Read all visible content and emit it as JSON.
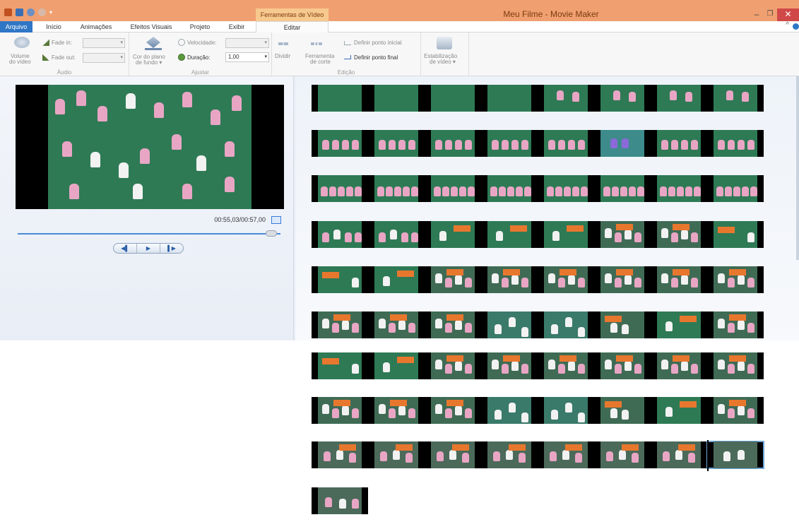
{
  "colors": {
    "titlebar": "#f0a070",
    "accent": "#2f76c6",
    "context_tab": "#f7c98f",
    "close": "#d04848",
    "scene_green": "#2e7a55",
    "figure_pink": "#e8a6c4",
    "figure_white": "#f2f2f2",
    "sign_orange": "#e8772e"
  },
  "window": {
    "title": "Meu Filme - Movie Maker",
    "context_tab_header": "Ferramentas de Vídeo",
    "controls": {
      "minimize": "–",
      "restore": "❐",
      "close": "✕"
    },
    "quick_access_icons": [
      "app-icon",
      "save-icon",
      "undo-icon",
      "redo-icon",
      "customize-icon"
    ]
  },
  "tabs": [
    {
      "label": "Arquivo"
    },
    {
      "label": "Início"
    },
    {
      "label": "Animações"
    },
    {
      "label": "Efeitos Visuais"
    },
    {
      "label": "Projeto"
    },
    {
      "label": "Exibir"
    },
    {
      "label": "Editar"
    }
  ],
  "ribbon": {
    "audio": {
      "group_label": "Áudio",
      "volume_label_1": "Volume",
      "volume_label_2": "do vídeo",
      "fade_in_label": "Fade in:",
      "fade_out_label": "Fade out:"
    },
    "adjust": {
      "group_label": "Ajustar",
      "bg_color_label_1": "Cor do plano",
      "bg_color_label_2": "de fundo ▾",
      "speed_label": "Velocidade:",
      "duration_label": "Duração:",
      "duration_value": "1,00"
    },
    "edit": {
      "group_label": "Edição",
      "split_label": "Dividir",
      "trim_label_1": "Ferramenta",
      "trim_label_2": "de corte",
      "set_start_label": "Definir ponto inicial",
      "set_end_label": "Definir ponto final"
    },
    "stabilization": {
      "label_1": "Estabilização",
      "label_2": "de vídeo ▾"
    }
  },
  "preview": {
    "time_current": "00:55,03",
    "time_total": "00:57,00",
    "time_readout": "00:55,03/00:57,00",
    "progress": 0.965,
    "transport": {
      "prev": "◀▌",
      "play": "▶",
      "next": "▌▶"
    }
  },
  "storyboard": {
    "rows": [
      [
        "green",
        "green",
        "green",
        "green",
        "pink-few",
        "pink-few",
        "pink-few",
        "pink-few"
      ],
      [
        "pink-line",
        "pink-line",
        "pink-line",
        "pink-line",
        "pink-line",
        "purple",
        "pink-line",
        "pink-line"
      ],
      [
        "pink-chain",
        "pink-chain",
        "pink-chain",
        "pink-chain",
        "pink-chain",
        "pink-chain",
        "pink-chain",
        "pink-chain"
      ],
      [
        "chain-white",
        "chain-white",
        "white-sign",
        "white-sign",
        "white-sign",
        "crowd",
        "crowd",
        "sign-large"
      ],
      [
        "sign-large",
        "white-sign",
        "crowd",
        "crowd",
        "crowd",
        "crowd",
        "crowd",
        "crowd"
      ],
      [
        "crowd",
        "crowd",
        "crowd",
        "scatter",
        "scatter",
        "sign-white",
        "white-sign",
        "crowd"
      ],
      [
        "sign-large",
        "white-sign",
        "crowd",
        "crowd",
        "crowd",
        "crowd",
        "crowd",
        "crowd"
      ],
      [
        "crowd",
        "crowd",
        "crowd",
        "scatter",
        "scatter",
        "sign-white",
        "white-sign",
        "crowd"
      ],
      [
        "blur",
        "blur",
        "blur",
        "blur",
        "blur",
        "blur",
        "blur",
        "selected"
      ],
      [
        "blur-end"
      ]
    ]
  }
}
